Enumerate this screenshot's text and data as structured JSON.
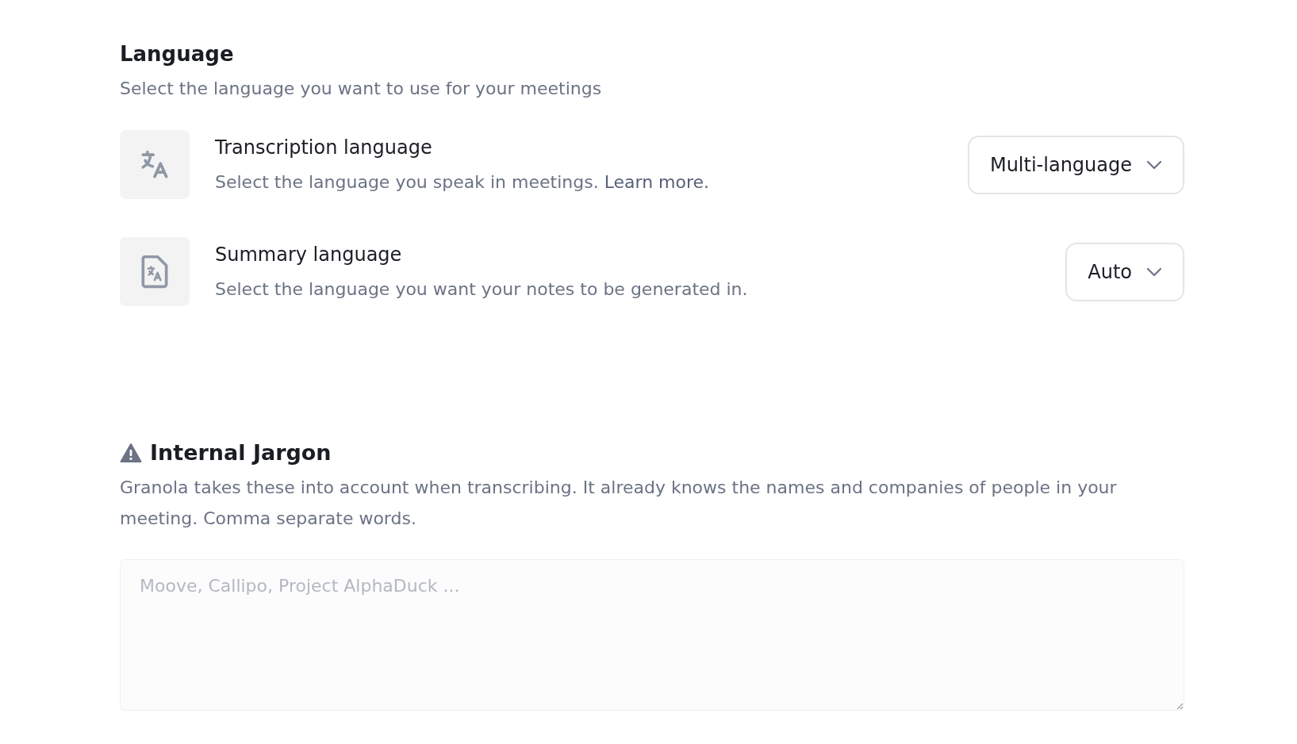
{
  "language_section": {
    "title": "Language",
    "description": "Select the language you want to use for your meetings",
    "settings": [
      {
        "kind": "translate",
        "title": "Transcription language",
        "description": "Select the language you speak in meetings.",
        "link": "Learn more.",
        "value": "Multi-language"
      },
      {
        "kind": "document",
        "title": "Summary language",
        "description": "Select the language you want your notes to be generated in.",
        "value": "Auto"
      }
    ]
  },
  "jargon_section": {
    "title": "Internal Jargon",
    "description": "Granola takes these into account when transcribing. It already knows the names and companies of people in your meeting. Comma separate words.",
    "placeholder": "Moove, Callipo, Project AlphaDuck ..."
  }
}
